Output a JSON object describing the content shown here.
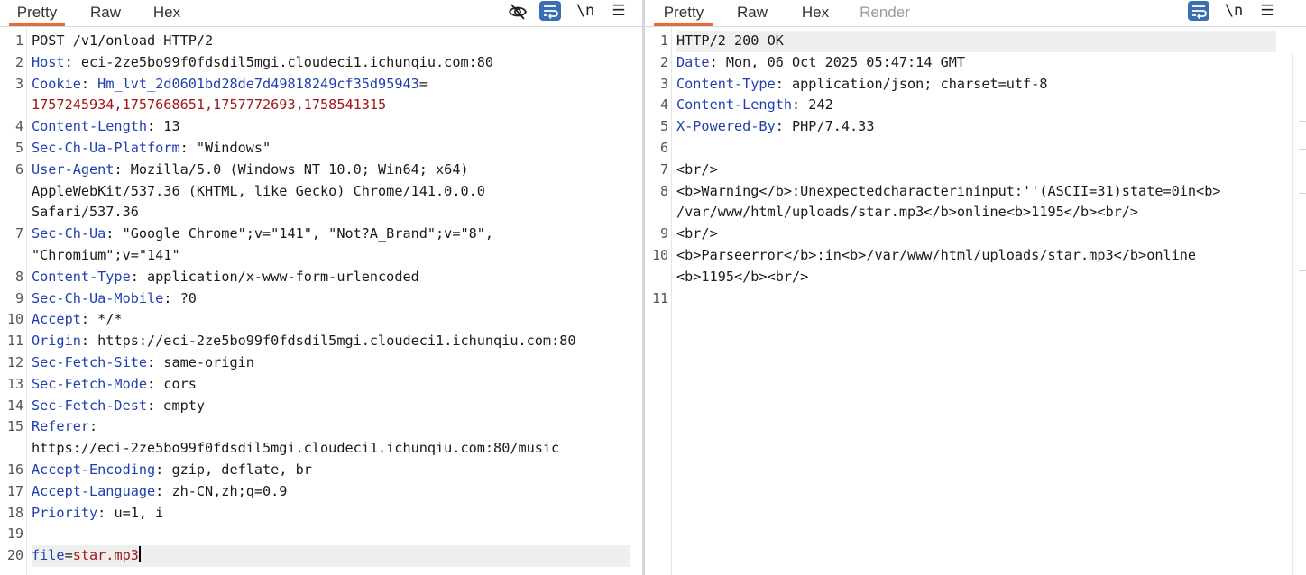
{
  "request": {
    "tabs": [
      "Pretty",
      "Raw",
      "Hex"
    ],
    "active_tab": "Pretty",
    "toolbar": {
      "hide_icon": "eye-slash-icon",
      "wrap_icon": "wrap-lines-icon",
      "newline_label": "\\n",
      "menu_icon": "hamburger-menu-icon"
    },
    "lines": [
      {
        "n": "1",
        "text": "POST /v1/onload HTTP/2"
      },
      {
        "n": "2",
        "key": "Host",
        "val": ": eci-2ze5bo99f0fdsdil5mgi.cloudeci1.ichunqiu.com:80"
      },
      {
        "n": "3",
        "key": "Cookie",
        "val": ": ",
        "cookie_name": "Hm_lvt_2d0601bd28de7d49818249cf35d95943",
        "eq": "="
      },
      {
        "n": "",
        "red": "1757245934,1757668651,1757772693,1758541315"
      },
      {
        "n": "4",
        "key": "Content-Length",
        "val": ": 13"
      },
      {
        "n": "5",
        "key": "Sec-Ch-Ua-Platform",
        "val": ": \"Windows\""
      },
      {
        "n": "6",
        "key": "User-Agent",
        "val": ": Mozilla/5.0 (Windows NT 10.0; Win64; x64)"
      },
      {
        "n": "",
        "text": "AppleWebKit/537.36 (KHTML, like Gecko) Chrome/141.0.0.0"
      },
      {
        "n": "",
        "text": "Safari/537.36"
      },
      {
        "n": "7",
        "key": "Sec-Ch-Ua",
        "val": ": \"Google Chrome\";v=\"141\", \"Not?A_Brand\";v=\"8\","
      },
      {
        "n": "",
        "text": "\"Chromium\";v=\"141\""
      },
      {
        "n": "8",
        "key": "Content-Type",
        "val": ": application/x-www-form-urlencoded"
      },
      {
        "n": "9",
        "key": "Sec-Ch-Ua-Mobile",
        "val": ": ?0"
      },
      {
        "n": "10",
        "key": "Accept",
        "val": ": */*"
      },
      {
        "n": "11",
        "key": "Origin",
        "val": ": https://eci-2ze5bo99f0fdsdil5mgi.cloudeci1.ichunqiu.com:80"
      },
      {
        "n": "12",
        "key": "Sec-Fetch-Site",
        "val": ": same-origin"
      },
      {
        "n": "13",
        "key": "Sec-Fetch-Mode",
        "val": ": cors"
      },
      {
        "n": "14",
        "key": "Sec-Fetch-Dest",
        "val": ": empty"
      },
      {
        "n": "15",
        "key": "Referer",
        "val": ":"
      },
      {
        "n": "",
        "text": "https://eci-2ze5bo99f0fdsdil5mgi.cloudeci1.ichunqiu.com:80/music"
      },
      {
        "n": "16",
        "key": "Accept-Encoding",
        "val": ": gzip, deflate, br"
      },
      {
        "n": "17",
        "key": "Accept-Language",
        "val": ": zh-CN,zh;q=0.9"
      },
      {
        "n": "18",
        "key": "Priority",
        "val": ": u=1, i"
      },
      {
        "n": "19",
        "text": ""
      },
      {
        "n": "20",
        "param_key": "file",
        "eq": "=",
        "param_val": "star.mp3",
        "current": true
      }
    ]
  },
  "response": {
    "tabs": [
      "Pretty",
      "Raw",
      "Hex",
      "Render"
    ],
    "active_tab": "Pretty",
    "toolbar": {
      "wrap_icon": "wrap-lines-icon",
      "newline_label": "\\n",
      "menu_icon": "hamburger-menu-icon"
    },
    "lines": [
      {
        "n": "1",
        "text": "HTTP/2 200 OK",
        "current": true
      },
      {
        "n": "2",
        "key": "Date",
        "val": ": Mon, 06 Oct 2025 05:47:14 GMT"
      },
      {
        "n": "3",
        "key": "Content-Type",
        "val": ": application/json; charset=utf-8"
      },
      {
        "n": "4",
        "key": "Content-Length",
        "val": ": 242"
      },
      {
        "n": "5",
        "key": "X-Powered-By",
        "val": ": PHP/7.4.33"
      },
      {
        "n": "6",
        "text": ""
      },
      {
        "n": "7",
        "text": "<br/>"
      },
      {
        "n": "8",
        "text": "<b>Warning</b>:Unexpectedcharacterininput:''(ASCII=31)state=0in<b>"
      },
      {
        "n": "",
        "text": "/var/www/html/uploads/star.mp3</b>online<b>1195</b><br/>"
      },
      {
        "n": "9",
        "text": "<br/>"
      },
      {
        "n": "10",
        "text": "<b>Parseerror</b>:in<b>/var/www/html/uploads/star.mp3</b>online"
      },
      {
        "n": "",
        "text": "<b>1195</b><br/>"
      },
      {
        "n": "11",
        "text": ""
      }
    ]
  }
}
